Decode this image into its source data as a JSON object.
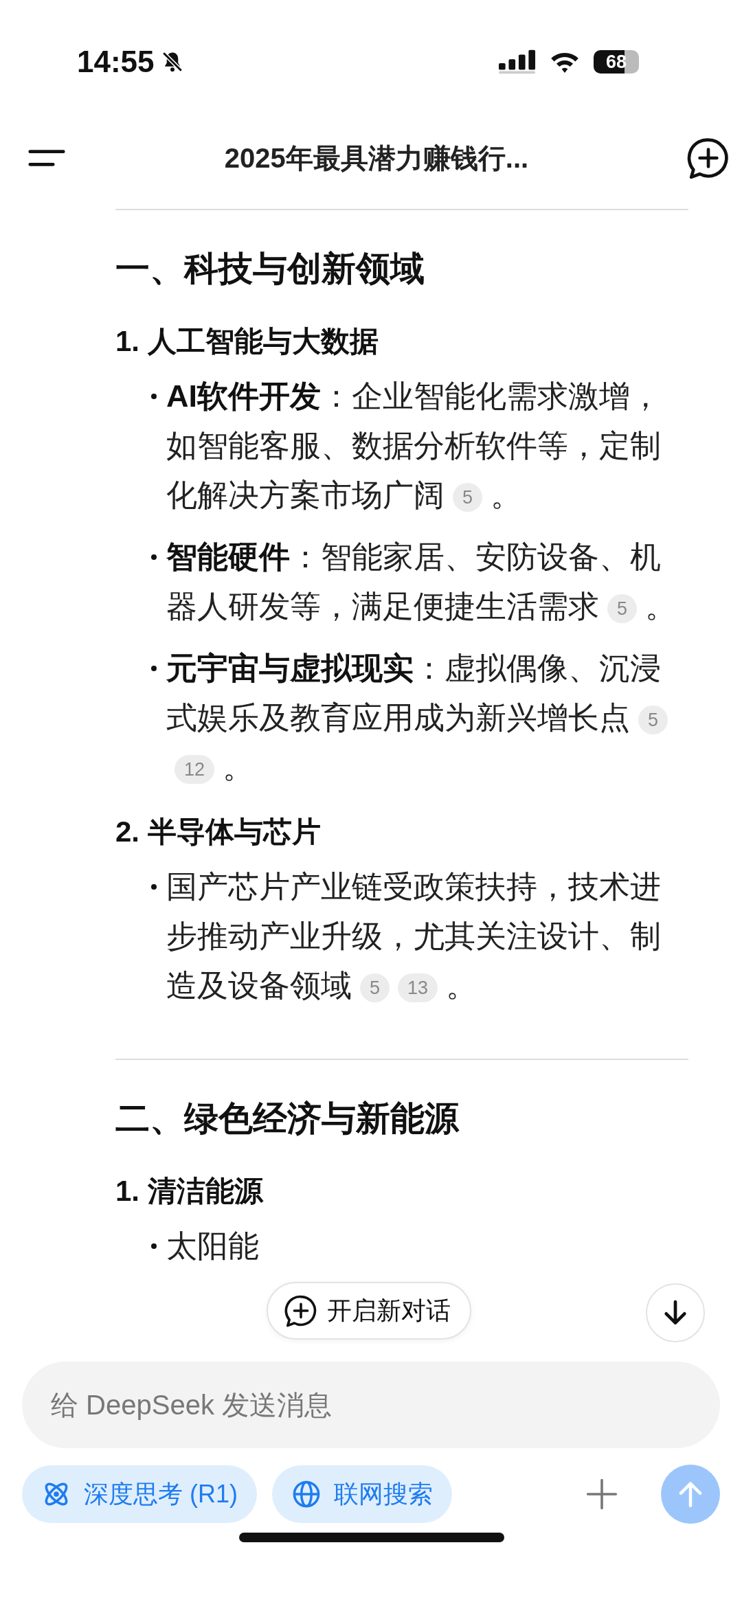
{
  "status_bar": {
    "time": "14:55",
    "silent": true,
    "battery": "68"
  },
  "header": {
    "title": "2025年最具潜力赚钱行..."
  },
  "sections": [
    {
      "heading": "一、科技与创新领域",
      "groups": [
        {
          "title": "1. 人工智能与大数据",
          "bullets": [
            {
              "text": "**AI软件开发**：企业智能化需求激增，如智能客服、数据分析软件等，定制化解决方案市场广阔",
              "citations": [
                "5"
              ],
              "end": "。"
            },
            {
              "text": "**智能硬件**：智能家居、安防设备、机器人研发等，满足便捷生活需求",
              "citations": [
                "5"
              ],
              "end": "。"
            },
            {
              "text": "**元宇宙与虚拟现实**：虚拟偶像、沉浸式娱乐及教育应用成为新兴增长点",
              "citations": [
                "5",
                "12"
              ],
              "end": "。"
            }
          ]
        },
        {
          "title": "2. 半导体与芯片",
          "bullets": [
            {
              "text": "国产芯片产业链受政策扶持，技术进步推动产业升级，尤其关注设计、制造及设备领域",
              "citations": [
                "5",
                "13"
              ],
              "end": "。"
            }
          ]
        }
      ]
    },
    {
      "heading": "二、绿色经济与新能源",
      "groups": [
        {
          "title": "1. 清洁能源",
          "bullets": [
            {
              "text": "太阳能"
            }
          ]
        }
      ]
    }
  ],
  "new_chat_button": {
    "label": "开启新对话"
  },
  "composer": {
    "placeholder": "给 DeepSeek 发送消息"
  },
  "toggles": [
    {
      "kind": "reasoning",
      "label": "深度思考 (R1)",
      "selected": true
    },
    {
      "kind": "search",
      "label": "联网搜索",
      "selected": true
    }
  ]
}
